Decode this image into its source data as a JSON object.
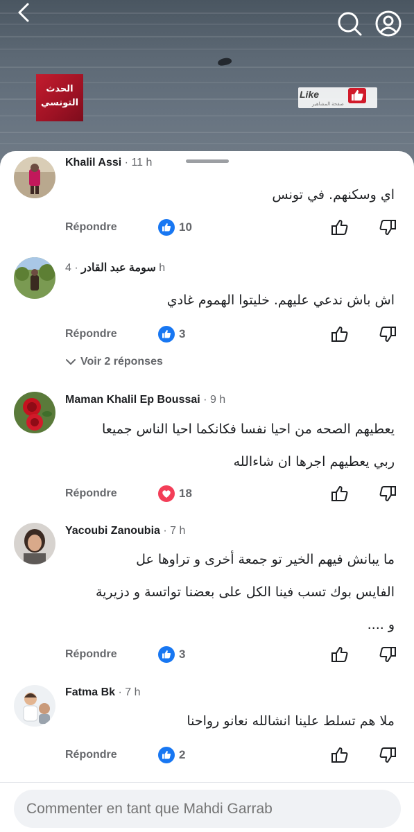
{
  "video": {
    "channel_logo_line1": "الحدث",
    "channel_logo_line2": "التونسي",
    "watermark_like": "Like",
    "watermark_sub": "صفحة المشاهير"
  },
  "comments": [
    {
      "author": "Khalil Assi",
      "time": "11 h",
      "text_lines": [
        "اي وسكنهم. في تونس"
      ],
      "reply_label": "Répondre",
      "reaction": "like",
      "count": "10"
    },
    {
      "author": "سومة عبد القادر",
      "time": "4 h",
      "text_lines": [
        "اش باش ندعي عليهم. خليتوا الهموم غادي"
      ],
      "reply_label": "Répondre",
      "reaction": "like",
      "count": "3",
      "view_replies": "Voir 2 réponses"
    },
    {
      "author": "Maman Khalil Ep Boussai",
      "time": "9 h",
      "text_lines": [
        "يعطيهم الصحه من احيا نفسا فكانكما احيا الناس جميعا",
        "ربي يعطيهم اجرها ان شاءالله"
      ],
      "reply_label": "Répondre",
      "reaction": "love",
      "count": "18"
    },
    {
      "author": "Yacoubi Zanoubia",
      "time": "7 h",
      "text_lines": [
        "ما يبانش فيهم الخير تو جمعة أخرى و تراوها عل",
        "الفايس بوك تسب فينا الكل على بعضنا تواتسة و دزيرية",
        "و ...."
      ],
      "reply_label": "Répondre",
      "reaction": "like",
      "count": "3"
    },
    {
      "author": "Fatma Bk",
      "time": "7 h",
      "text_lines": [
        "ملا هم تسلط علينا انشالله نعانو رواحنا"
      ],
      "reply_label": "Répondre",
      "reaction": "like",
      "count": "2"
    }
  ],
  "composer": {
    "placeholder": "Commenter en tant que Mahdi Garrab"
  },
  "colors": {
    "like_blue": "#1877f2",
    "love_red": "#f33e58",
    "secondary_text": "#65676b",
    "input_bg": "#f0f2f5"
  }
}
